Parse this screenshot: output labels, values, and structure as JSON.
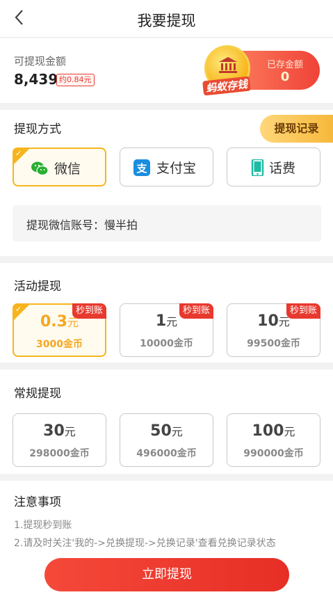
{
  "header": {
    "title": "我要提现",
    "back_icon": "chevron-left-icon"
  },
  "balance": {
    "label": "可提现金额",
    "amount": "8,439",
    "approx": "约0.84元",
    "saved_label": "已存金额",
    "saved_value": "0",
    "saved_brand": "蚂蚁存钱",
    "saved_icon": "bank-icon"
  },
  "withdraw_method": {
    "title": "提现方式",
    "record_button": "提现记录",
    "methods": [
      {
        "label": "微信",
        "icon": "wechat-icon",
        "color": "#2aae31",
        "selected": true
      },
      {
        "label": "支付宝",
        "icon": "alipay-icon",
        "color": "#1a8de0",
        "selected": false
      },
      {
        "label": "话费",
        "icon": "phone-icon",
        "color": "#1dbba4",
        "selected": false
      }
    ],
    "account_text": "提现微信账号：慢半拍"
  },
  "activity": {
    "title": "活动提现",
    "options": [
      {
        "amount": "0.3",
        "unit": "元",
        "coins": "3000金币",
        "badge": "秒到账",
        "selected": true
      },
      {
        "amount": "1",
        "unit": "元",
        "coins": "10000金币",
        "badge": "秒到账",
        "selected": false
      },
      {
        "amount": "10",
        "unit": "元",
        "coins": "99500金币",
        "badge": "秒到账",
        "selected": false
      }
    ]
  },
  "regular": {
    "title": "常规提现",
    "options": [
      {
        "amount": "30",
        "unit": "元",
        "coins": "298000金币"
      },
      {
        "amount": "50",
        "unit": "元",
        "coins": "496000金币"
      },
      {
        "amount": "100",
        "unit": "元",
        "coins": "990000金币"
      }
    ]
  },
  "notes": {
    "title": "注意事项",
    "items": [
      "1.提现秒到账",
      "2.请及时关注'我的->兑换提现->兑换记录'查看兑换记录状态"
    ]
  },
  "submit_button": "立即提现",
  "colors": {
    "accent": "#f6b51e",
    "primary_red": "#e8392e"
  }
}
